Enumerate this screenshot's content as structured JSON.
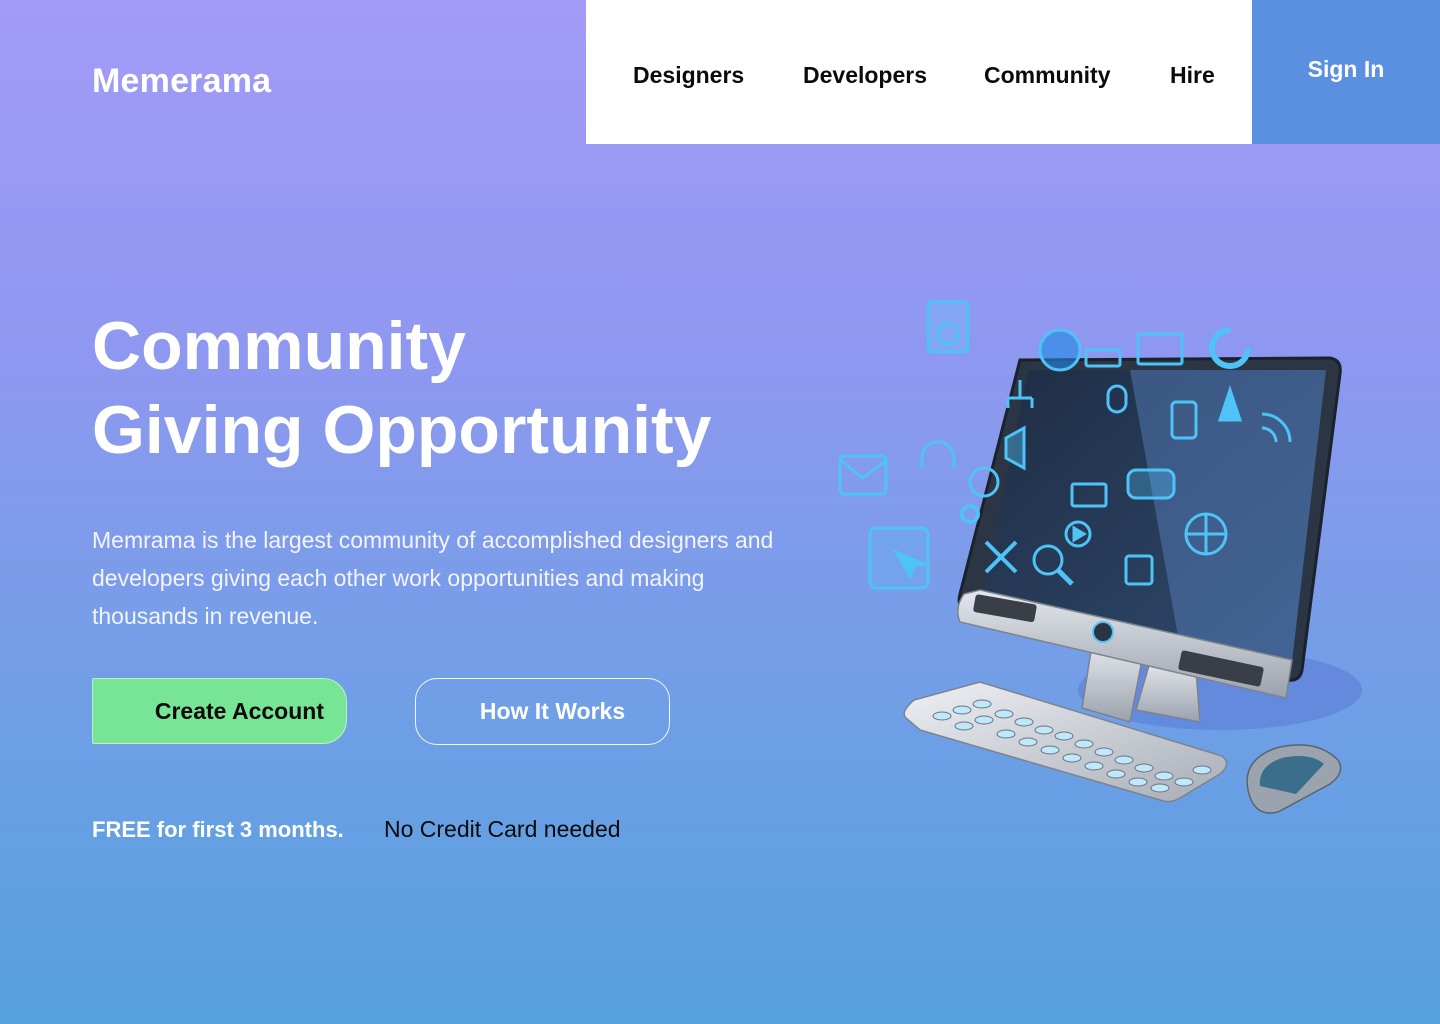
{
  "brand": {
    "name": "Memerama"
  },
  "nav": {
    "items": [
      {
        "label": "Designers"
      },
      {
        "label": "Developers"
      },
      {
        "label": "Community"
      },
      {
        "label": "Hire"
      }
    ],
    "signin_label": "Sign In"
  },
  "hero": {
    "title_line1": "Community",
    "title_line2": "Giving Opportunity",
    "description": "Memrama is the largest community of accomplished designers and developers giving each other work opportunities and making thousands in revenue.",
    "primary_cta": "Create Account",
    "secondary_cta": "How It Works",
    "free_note": "FREE for first 3 months.",
    "no_card_note": "No Credit Card needed"
  },
  "colors": {
    "gradient_top": "#a29bf7",
    "gradient_bottom": "#55a0de",
    "signin_bg": "#5b8fe0",
    "cta_green": "#78e496",
    "icon_cyan": "#4fc3f7"
  },
  "illustration": {
    "subject": "computer-with-app-icons",
    "icons": [
      "speaker-icon",
      "music-icon",
      "keyboard-icon",
      "monitor-icon",
      "refresh-icon",
      "network-icon",
      "antenna-icon",
      "microphone-icon",
      "phone-icon",
      "wifi-icon",
      "headphones-icon",
      "volume-icon",
      "mail-icon",
      "globe-icon",
      "gear-icon",
      "cursor-window-icon",
      "search-icon",
      "play-icon",
      "game-controller-icon",
      "calendar-icon",
      "film-icon",
      "tools-icon"
    ]
  }
}
